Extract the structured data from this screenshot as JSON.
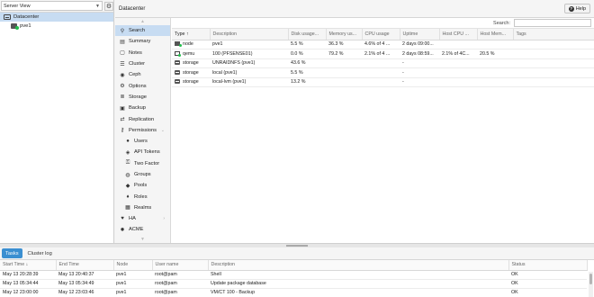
{
  "tree": {
    "view_select": "Server View",
    "items": [
      {
        "label": "Datacenter",
        "icon": "datacenter-icon"
      },
      {
        "label": "pve1",
        "icon": "server-icon"
      }
    ]
  },
  "header": {
    "title": "Datacenter",
    "help_label": "Help"
  },
  "menu": {
    "items": [
      {
        "label": "Search",
        "icon": "search-icon",
        "glyph": "⚲"
      },
      {
        "label": "Summary",
        "icon": "summary-icon",
        "glyph": "▤"
      },
      {
        "label": "Notes",
        "icon": "notes-icon",
        "glyph": "▢"
      },
      {
        "label": "Cluster",
        "icon": "cluster-icon",
        "glyph": "☰"
      },
      {
        "label": "Ceph",
        "icon": "ceph-icon",
        "glyph": "◉"
      },
      {
        "label": "Options",
        "icon": "gear-icon",
        "glyph": "⚙"
      },
      {
        "label": "Storage",
        "icon": "database-icon",
        "glyph": "≣"
      },
      {
        "label": "Backup",
        "icon": "floppy-icon",
        "glyph": "▣"
      },
      {
        "label": "Replication",
        "icon": "retweet-icon",
        "glyph": "⇄"
      },
      {
        "label": "Permissions",
        "icon": "unlock-icon",
        "glyph": "⚷"
      },
      {
        "label": "Users",
        "icon": "user-icon",
        "glyph": "●"
      },
      {
        "label": "API Tokens",
        "icon": "user-tag-icon",
        "glyph": "◈"
      },
      {
        "label": "Two Factor",
        "icon": "key-icon",
        "glyph": "⚿"
      },
      {
        "label": "Groups",
        "icon": "users-icon",
        "glyph": "◍"
      },
      {
        "label": "Pools",
        "icon": "tags-icon",
        "glyph": "◆"
      },
      {
        "label": "Roles",
        "icon": "male-icon",
        "glyph": "♦"
      },
      {
        "label": "Realms",
        "icon": "address-book-icon",
        "glyph": "▦"
      },
      {
        "label": "HA",
        "icon": "heartbeat-icon",
        "glyph": "♥"
      },
      {
        "label": "ACME",
        "icon": "certificate-icon",
        "glyph": "✹"
      }
    ]
  },
  "search": {
    "label": "Search:"
  },
  "resources": {
    "columns": [
      "Type ↑",
      "Description",
      "Disk usage...",
      "Memory us...",
      "CPU usage",
      "Uptime",
      "Host CPU ...",
      "Host Mem...",
      "Tags"
    ],
    "rows": [
      {
        "type": "node",
        "icon": "node",
        "description": "pve1",
        "disk": "5.5 %",
        "memory": "36.3 %",
        "cpu": "4.6% of 4 ...",
        "uptime": "2 days 09:00...",
        "host_cpu": "",
        "host_mem": "",
        "tags": ""
      },
      {
        "type": "qemu",
        "icon": "vm",
        "description": "100 (PFSENSE01)",
        "disk": "0.0 %",
        "memory": "79.2 %",
        "cpu": "2.1% of 4 ...",
        "uptime": "2 days 08:59...",
        "host_cpu": "2.1% of 4C...",
        "host_mem": "20.5 %",
        "tags": ""
      },
      {
        "type": "storage",
        "icon": "storage",
        "description": "UNRAIDNFS (pve1)",
        "disk": "43.6 %",
        "memory": "",
        "cpu": "",
        "uptime": "-",
        "host_cpu": "",
        "host_mem": "",
        "tags": ""
      },
      {
        "type": "storage",
        "icon": "storage",
        "description": "local (pve1)",
        "disk": "5.5 %",
        "memory": "",
        "cpu": "",
        "uptime": "-",
        "host_cpu": "",
        "host_mem": "",
        "tags": ""
      },
      {
        "type": "storage",
        "icon": "storage",
        "description": "local-lvm (pve1)",
        "disk": "13.2 %",
        "memory": "",
        "cpu": "",
        "uptime": "-",
        "host_cpu": "",
        "host_mem": "",
        "tags": ""
      }
    ]
  },
  "log": {
    "tabs": [
      "Tasks",
      "Cluster log"
    ],
    "columns": [
      "Start Time ↓",
      "End Time",
      "Node",
      "User name",
      "Description",
      "Status"
    ],
    "rows": [
      {
        "start": "May 13 20:28:39",
        "end": "May 13 20:40:37",
        "node": "pve1",
        "user": "root@pam",
        "description": "Shell",
        "status": "OK"
      },
      {
        "start": "May 13 05:34:44",
        "end": "May 13 05:34:49",
        "node": "pve1",
        "user": "root@pam",
        "description": "Update package database",
        "status": "OK"
      },
      {
        "start": "May 12 23:00:00",
        "end": "May 12 23:03:46",
        "node": "pve1",
        "user": "root@pam",
        "description": "VM/CT 100 - Backup",
        "status": "OK"
      }
    ]
  },
  "colors": {
    "selection": "#c7dcf2",
    "accent": "#3b8fd1",
    "running": "#21bf4b"
  }
}
